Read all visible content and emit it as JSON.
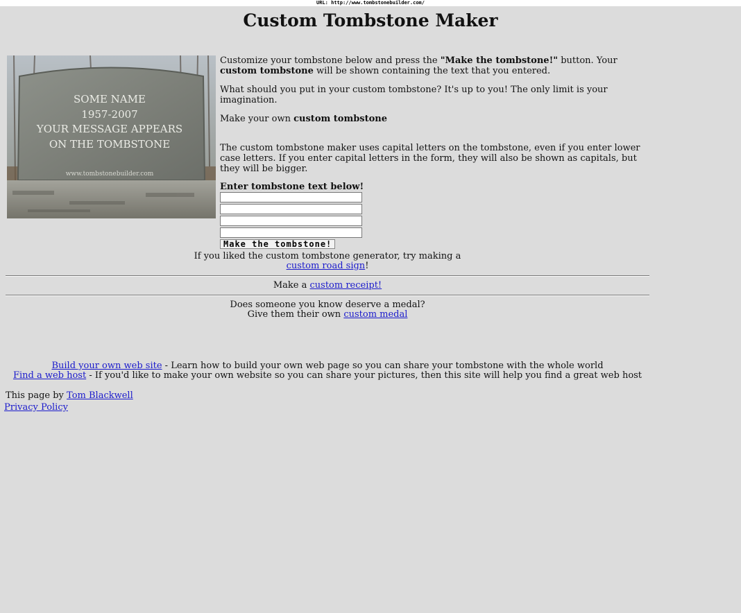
{
  "url_bar": "URL: http://www.tombstonebuilder.com/",
  "page_title": "Custom Tombstone Maker",
  "tombstone_image": {
    "lines": [
      "SOME NAME",
      "1957-2007",
      "YOUR MESSAGE APPEARS",
      "ON THE TOMBSTONE"
    ],
    "watermark": "www.tombstonebuilder.com"
  },
  "intro": {
    "p1_a": "Customize your tombstone below and press the ",
    "p1_b": "\"Make the tombstone!\"",
    "p1_c": " button. Your ",
    "p1_d": "custom tombstone",
    "p1_e": " will be shown containing the text that you entered.",
    "p2": "What should you put in your custom tombstone? It's up to you! The only limit is your imagination.",
    "p3_a": "Make your own ",
    "p3_b": "custom tombstone",
    "p4": "The custom tombstone maker uses capital letters on the tombstone, even if you enter lower case letters. If you enter capital letters in the form, they will also be shown as capitals, but they will be bigger."
  },
  "form": {
    "label": "Enter tombstone text below!",
    "inputs": [
      "",
      "",
      "",
      ""
    ],
    "button": "Make the tombstone!"
  },
  "promos": {
    "road_a": "If you liked the custom tombstone generator, try making a",
    "road_link": "custom road sign",
    "road_b": "!",
    "receipt_a": "Make a ",
    "receipt_link": "custom receipt!",
    "medal_a": "Does someone you know deserve a medal?",
    "medal_b": "Give them their own ",
    "medal_link": "custom medal"
  },
  "footer_links": {
    "build_link": "Build your own web site",
    "build_text": " - Learn how to build your own web page so you can share your tombstone with the whole world",
    "host_link": "Find a web host",
    "host_text": " - If you'd like to make your own website so you can share your pictures, then this site will help you find a great web host"
  },
  "byline": {
    "text": "This page by ",
    "author": "Tom Blackwell",
    "privacy": "Privacy Policy"
  }
}
